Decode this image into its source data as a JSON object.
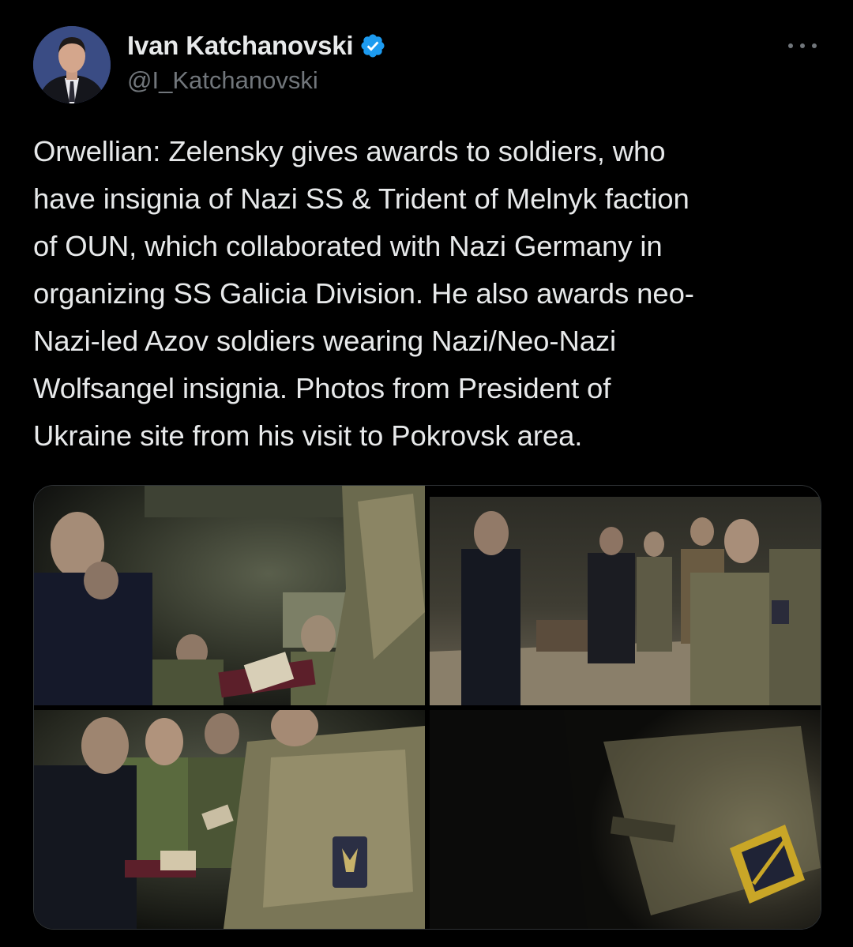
{
  "author": {
    "display_name": "Ivan Katchanovski",
    "handle": "@I_Katchanovski",
    "verified": true,
    "verified_icon": "verified-badge-icon",
    "avatar_icon": "profile-photo"
  },
  "more_icon": "more-horizontal-icon",
  "tweet": {
    "text": "Orwellian: Zelensky gives awards to soldiers, who\nhave insignia of Nazi SS & Trident of Melnyk faction\nof OUN, which collaborated with Nazi Germany in\norganizing SS Galicia Division. He also awards neo-\nNazi-led Azov soldiers wearing Nazi/Neo-Nazi\nWolfsangel insignia. Photos from President of\nUkraine site from his visit to Pokrovsk area."
  },
  "media": {
    "count": 4
  },
  "colors": {
    "background": "#000000",
    "text_primary": "#e7e9ea",
    "text_secondary": "#71767b",
    "verified_blue": "#1d9bf0",
    "border": "#2f3336"
  }
}
